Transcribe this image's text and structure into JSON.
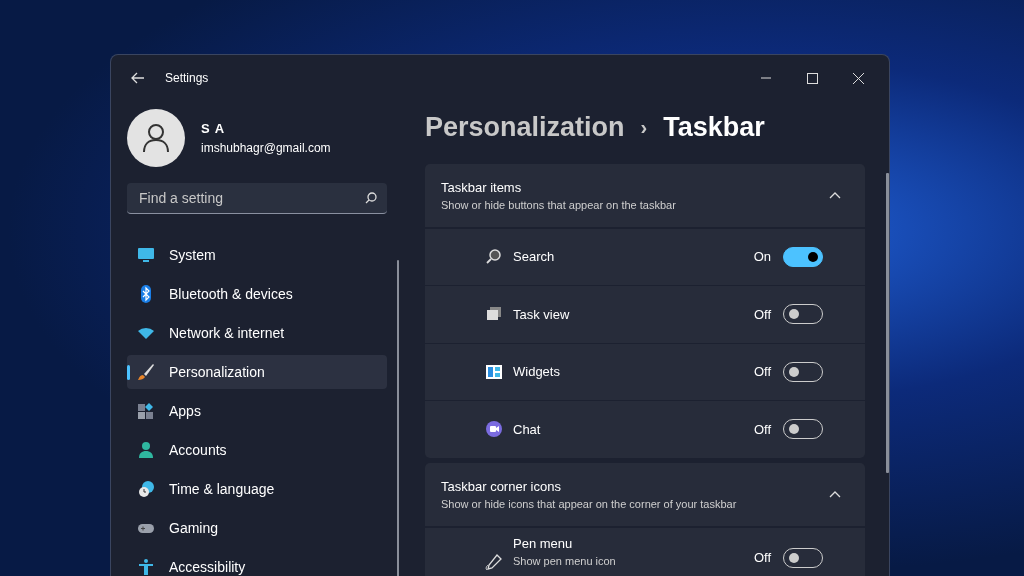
{
  "window": {
    "title": "Settings"
  },
  "user": {
    "name": "S A",
    "email": "imshubhagr@gmail.com"
  },
  "search": {
    "placeholder": "Find a setting"
  },
  "sidebar": {
    "items": [
      {
        "label": "System",
        "selected": false
      },
      {
        "label": "Bluetooth & devices",
        "selected": false
      },
      {
        "label": "Network & internet",
        "selected": false
      },
      {
        "label": "Personalization",
        "selected": true
      },
      {
        "label": "Apps",
        "selected": false
      },
      {
        "label": "Accounts",
        "selected": false
      },
      {
        "label": "Time & language",
        "selected": false
      },
      {
        "label": "Gaming",
        "selected": false
      },
      {
        "label": "Accessibility",
        "selected": false
      }
    ]
  },
  "breadcrumb": [
    {
      "label": "Personalization",
      "selected": false
    },
    {
      "label": "Taskbar",
      "selected": true
    }
  ],
  "breadcrumb_separator": "›",
  "sections": [
    {
      "title": "Taskbar items",
      "subtitle": "Show or hide buttons that appear on the taskbar",
      "expanded": true,
      "rows": [
        {
          "label": "Search",
          "state_text": "On",
          "on": true
        },
        {
          "label": "Task view",
          "state_text": "Off",
          "on": false
        },
        {
          "label": "Widgets",
          "state_text": "Off",
          "on": false
        },
        {
          "label": "Chat",
          "state_text": "Off",
          "on": false
        }
      ]
    },
    {
      "title": "Taskbar corner icons",
      "subtitle": "Show or hide icons that appear on the corner of your taskbar",
      "expanded": true,
      "rows": [
        {
          "label": "Pen menu",
          "description": "Show pen menu icon",
          "state_text": "Off",
          "on": false
        }
      ]
    }
  ]
}
